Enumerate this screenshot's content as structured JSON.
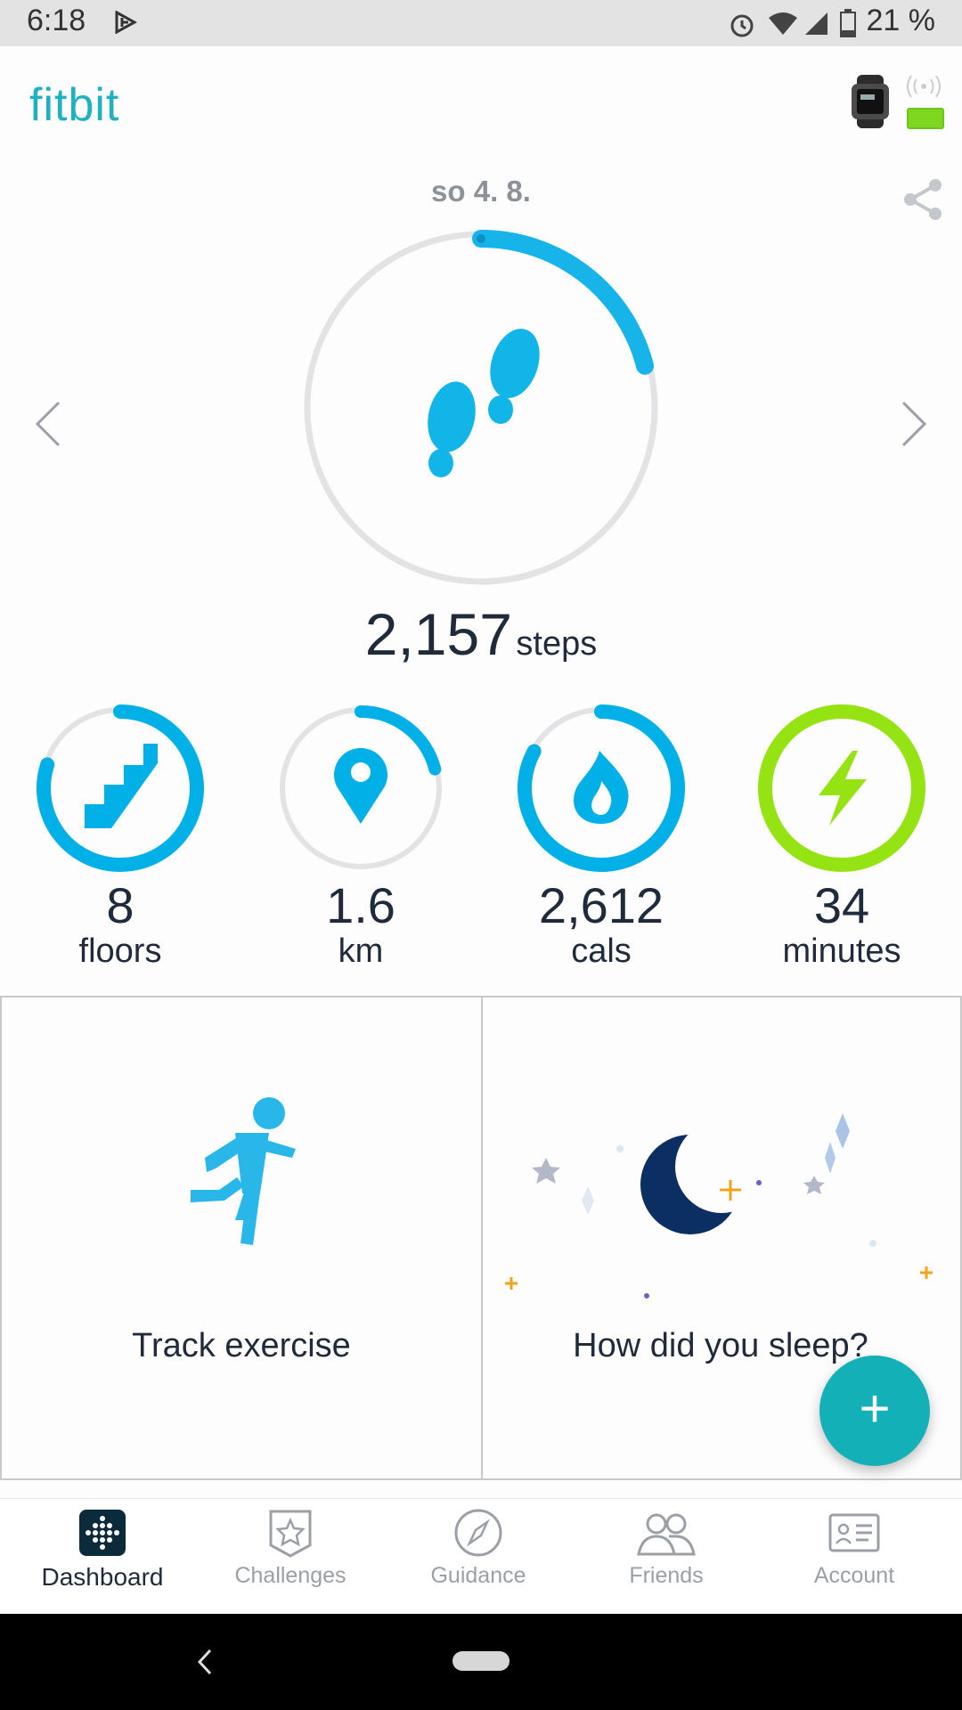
{
  "status_bar": {
    "time": "6:18",
    "battery": "21 %"
  },
  "app": {
    "logo": "fitbit",
    "device_icon": "watch-icon"
  },
  "date": "so 4. 8.",
  "steps": {
    "value": "2,157",
    "unit": "steps",
    "progress": 0.21
  },
  "stats": [
    {
      "value": "8",
      "label": "floors",
      "icon": "stairs-icon",
      "progress": 0.8,
      "color": "#00b0e6"
    },
    {
      "value": "1.6",
      "label": "km",
      "icon": "location-pin-icon",
      "progress": 0.21,
      "color": "#00b0e6"
    },
    {
      "value": "2,612",
      "label": "cals",
      "icon": "flame-icon",
      "progress": 0.83,
      "color": "#00b0e6"
    },
    {
      "value": "34",
      "label": "minutes",
      "icon": "lightning-icon",
      "progress": 1.0,
      "color": "#96e314"
    }
  ],
  "tiles": {
    "exercise_label": "Track exercise",
    "sleep_label": "How did you sleep?"
  },
  "fab_symbol": "+",
  "nav": {
    "dashboard": "Dashboard",
    "challenges": "Challenges",
    "guidance": "Guidance",
    "friends": "Friends",
    "account": "Account"
  },
  "colors": {
    "brand": "#1fb1bf",
    "accent": "#00b0e6",
    "active_minutes": "#96e314",
    "moon": "#0b2e63"
  }
}
